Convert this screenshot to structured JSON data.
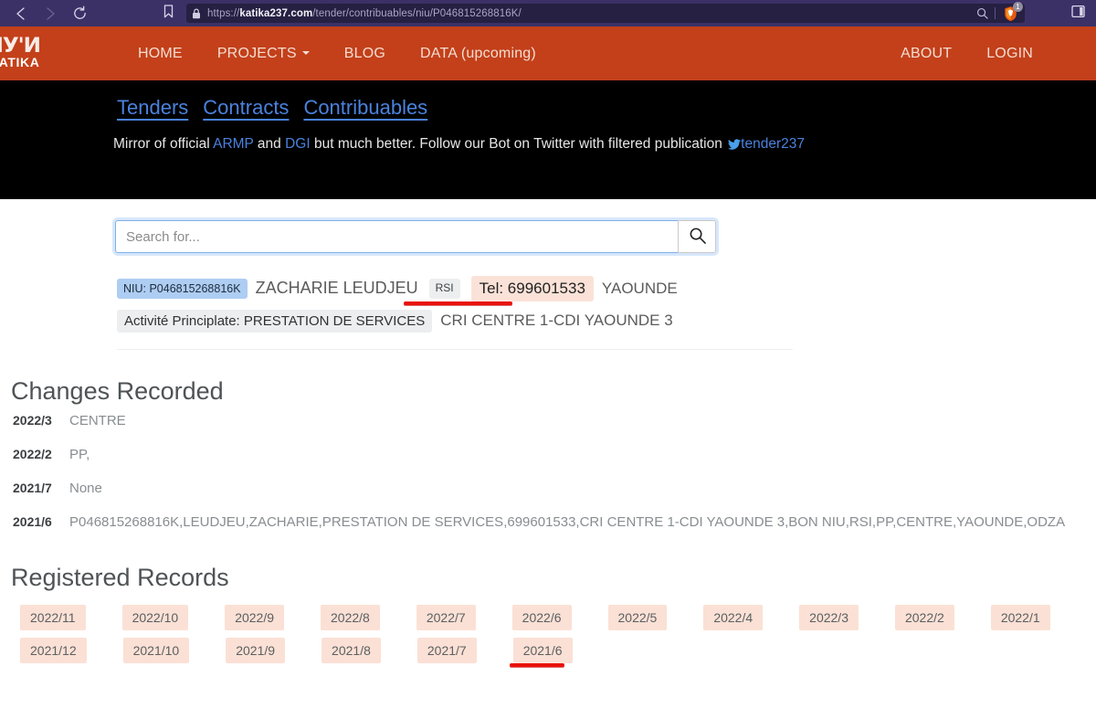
{
  "browser": {
    "url_prefix": "https://",
    "url_domain": "katika237.com",
    "url_path": "/tender/contribuables/niu/P046815268816K/",
    "back_icon": "back-arrow-icon",
    "forward_icon": "forward-arrow-icon",
    "reload_icon": "reload-icon",
    "bookmark_icon": "bookmark-icon",
    "lock_icon": "lock-icon",
    "zoom_icon": "search-zoom-icon",
    "shield_icon": "brave-shield-icon",
    "shield_count": "1",
    "panel_icon": "side-panel-icon"
  },
  "site_nav": {
    "logo_mark": "ИУ'И",
    "logo_word": "KATIKA",
    "links": [
      {
        "label": "HOME",
        "has_caret": false
      },
      {
        "label": "PROJECTS",
        "has_caret": true
      },
      {
        "label": "BLOG",
        "has_caret": false
      },
      {
        "label": "DATA (upcoming)",
        "has_caret": false
      }
    ],
    "right_links": [
      {
        "label": "ABOUT"
      },
      {
        "label": "LOGIN"
      }
    ]
  },
  "banner": {
    "tabs": [
      {
        "label": "Tenders"
      },
      {
        "label": "Contracts"
      },
      {
        "label": "Contribuables"
      }
    ],
    "sub_part1": "Mirror of official ",
    "sub_link1": "ARMP",
    "sub_part2": " and ",
    "sub_link2": "DGI",
    "sub_part3": " but much better. Follow our Bot on Twitter with filtered publication ",
    "twitter_icon": "twitter-bird-icon",
    "twitter_handle": "tender237"
  },
  "search": {
    "placeholder": "Search for...",
    "value": "",
    "button_icon": "search-icon"
  },
  "entity": {
    "niu_badge": "NIU: P046815268816K",
    "name": "ZACHARIE LEUDJEU",
    "rsi_badge": "RSI",
    "tel_badge": "Tel: 699601533",
    "city": "YAOUNDE",
    "activity_badge": "Activité Principlate: PRESTATION DE SERVICES",
    "cri": "CRI CENTRE 1-CDI YAOUNDE 3"
  },
  "changes": {
    "title": "Changes Recorded",
    "rows": [
      {
        "date": "2022/3",
        "value": "CENTRE"
      },
      {
        "date": "2022/2",
        "value": "PP,"
      },
      {
        "date": "2021/7",
        "value": "None"
      },
      {
        "date": "2021/6",
        "value": "P046815268816K,LEUDJEU,ZACHARIE,PRESTATION DE SERVICES,699601533,CRI CENTRE 1-CDI YAOUNDE 3,BON NIU,RSI,PP,CENTRE,YAOUNDE,ODZA"
      }
    ]
  },
  "records": {
    "title": "Registered Records",
    "tags": [
      "2022/11",
      "2022/10",
      "2022/9",
      "2022/8",
      "2022/7",
      "2022/6",
      "2022/5",
      "2022/4",
      "2022/3",
      "2022/2",
      "2022/1",
      "2021/12",
      "2021/10",
      "2021/9",
      "2021/8",
      "2021/7",
      "2021/6"
    ],
    "highlighted_tag": "2021/6"
  },
  "annotations": {
    "color": "#e8120c",
    "underline_tel": "Tel: 699601533",
    "underline_record": "2021/6"
  }
}
